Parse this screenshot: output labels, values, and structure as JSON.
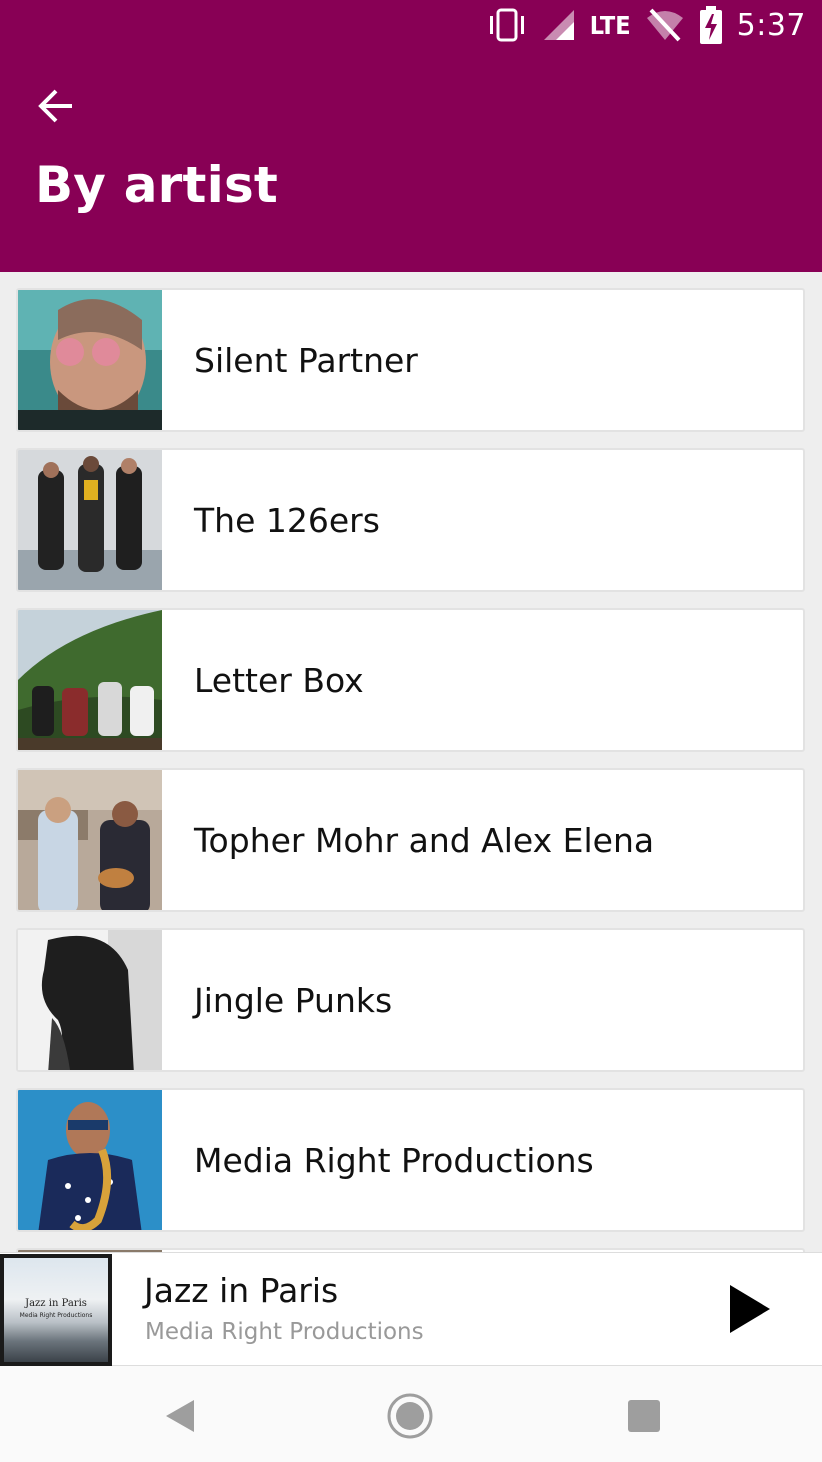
{
  "status_bar": {
    "time": "5:37",
    "network": "LTE",
    "icons": [
      "vibrate-icon",
      "signal-icon",
      "wifi-off-icon",
      "battery-charging-icon"
    ]
  },
  "header": {
    "title": "By artist",
    "back_icon": "arrow-back-icon",
    "color": "#880055"
  },
  "artists": [
    {
      "name": "Silent Partner"
    },
    {
      "name": "The 126ers"
    },
    {
      "name": "Letter Box"
    },
    {
      "name": "Topher Mohr and Alex Elena"
    },
    {
      "name": "Jingle Punks"
    },
    {
      "name": "Media Right Productions"
    }
  ],
  "now_playing": {
    "title": "Jazz in Paris",
    "artist": "Media Right Productions",
    "album_art_title": "Jazz in Paris",
    "album_art_subtitle": "Media Right Productions",
    "action_icon": "play-icon"
  },
  "nav_bar": {
    "icons": [
      "back-triangle-icon",
      "home-circle-icon",
      "recents-square-icon"
    ]
  }
}
